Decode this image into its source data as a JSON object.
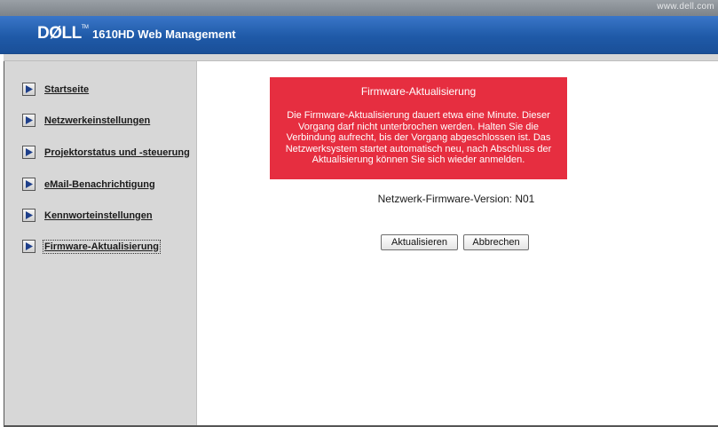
{
  "topbar": {
    "url": "www.dell.com"
  },
  "header": {
    "logo": "DØLL",
    "logo_tm": "TM",
    "title": "1610HD Web Management"
  },
  "sidebar": {
    "items": [
      {
        "label": "Startseite"
      },
      {
        "label": "Netzwerkeinstellungen"
      },
      {
        "label": "Projektorstatus und -steuerung"
      },
      {
        "label": "eMail-Benachrichtigung"
      },
      {
        "label": "Kennworteinstellungen"
      },
      {
        "label": "Firmware-Aktualisierung",
        "active": true
      }
    ]
  },
  "main": {
    "alert": {
      "title": "Firmware-Aktualisierung",
      "body": "Die Firmware-Aktualisierung dauert etwa eine Minute. Dieser Vorgang darf nicht unterbrochen werden. Halten Sie die Verbindung aufrecht, bis der Vorgang abgeschlossen ist. Das Netzwerksystem startet automatisch neu, nach Abschluss der Aktualisierung können Sie sich wieder anmelden.",
      "background_color": "#e62e40"
    },
    "firmware_version": "Netzwerk-Firmware-Version: N01",
    "buttons": {
      "update_label": "Aktualisieren",
      "cancel_label": "Abbrechen"
    }
  },
  "colors": {
    "header_blue": "#1f5aa8",
    "sidebar_gray": "#d7d7d7"
  },
  "icons": {
    "nav_arrow": "play-arrow-icon"
  }
}
